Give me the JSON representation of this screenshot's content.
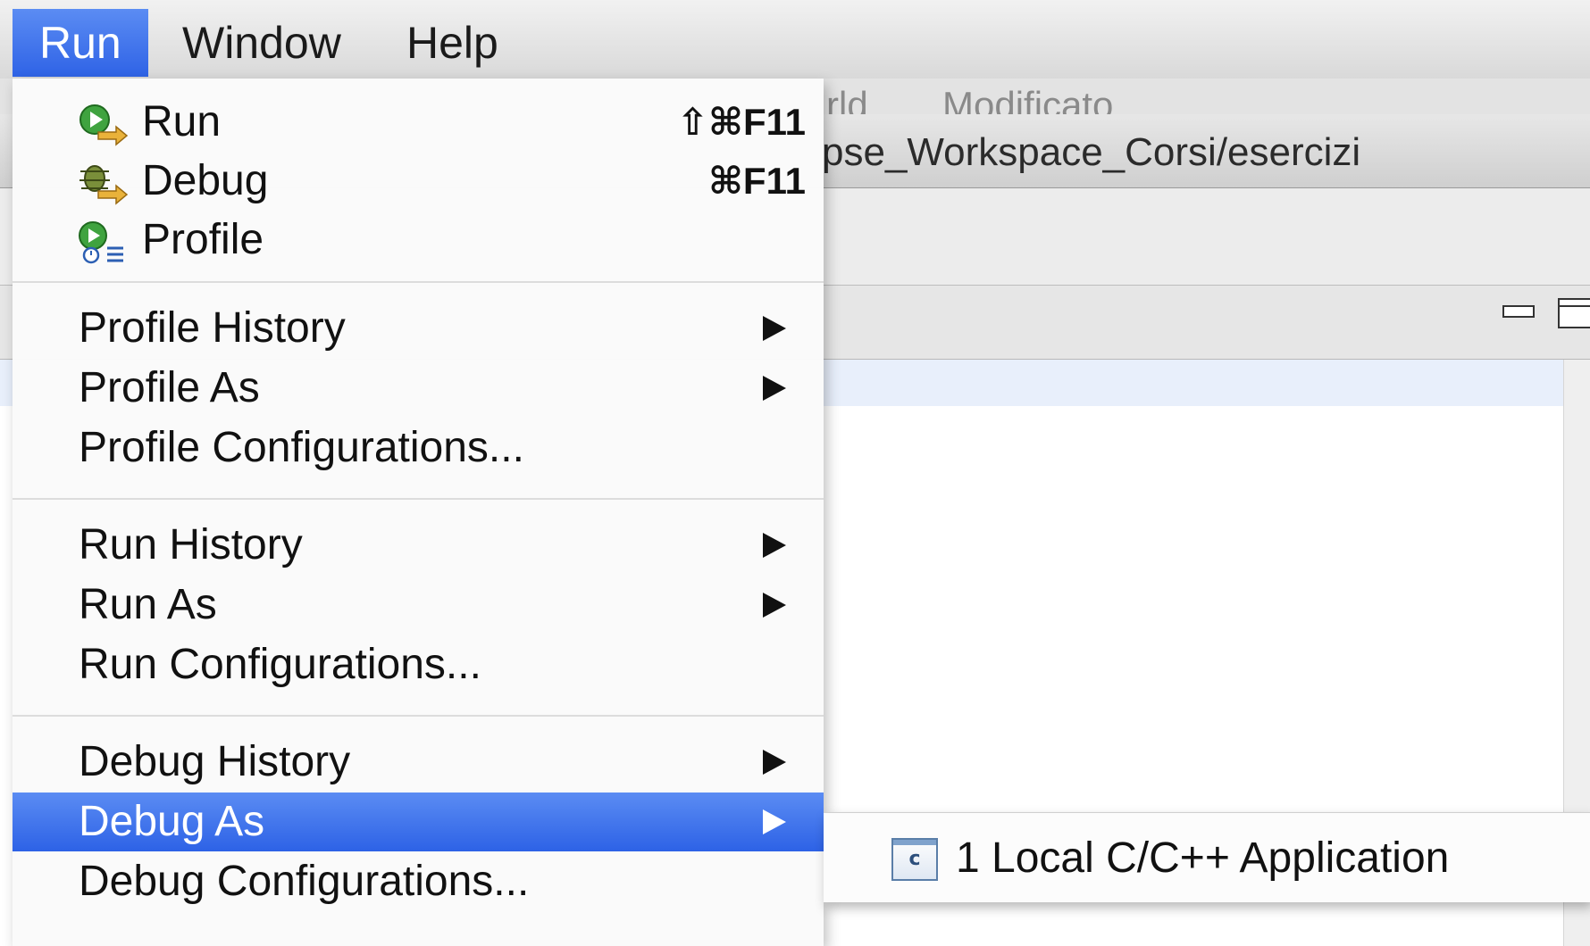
{
  "menubar": {
    "items": [
      {
        "label": "Run",
        "active": true
      },
      {
        "label": "Window",
        "active": false
      },
      {
        "label": "Help",
        "active": false
      }
    ]
  },
  "background_window": {
    "tabs": [
      "rld",
      "Modificato"
    ],
    "title": "pse_Workspace_Corsi/esercizi"
  },
  "run_menu": {
    "launch_items": [
      {
        "label": "Run",
        "shortcut": "⇧⌘F11",
        "icon": "run-icon"
      },
      {
        "label": "Debug",
        "shortcut": "⌘F11",
        "icon": "debug-icon"
      },
      {
        "label": "Profile",
        "shortcut": "",
        "icon": "profile-icon"
      }
    ],
    "profile_group": [
      {
        "label": "Profile History",
        "submenu": true
      },
      {
        "label": "Profile As",
        "submenu": true
      },
      {
        "label": "Profile Configurations...",
        "submenu": false
      }
    ],
    "run_group": [
      {
        "label": "Run History",
        "submenu": true
      },
      {
        "label": "Run As",
        "submenu": true
      },
      {
        "label": "Run Configurations...",
        "submenu": false
      }
    ],
    "debug_group": [
      {
        "label": "Debug History",
        "submenu": true
      },
      {
        "label": "Debug As",
        "submenu": true,
        "selected": true
      },
      {
        "label": "Debug Configurations...",
        "submenu": false
      }
    ]
  },
  "debug_as_submenu": {
    "items": [
      {
        "label": "1 Local C/C++ Application",
        "icon": "c-application-icon",
        "icon_letter": "c"
      }
    ]
  },
  "colors": {
    "selection_blue": "#2f63e6",
    "menu_background": "#fafafa"
  }
}
